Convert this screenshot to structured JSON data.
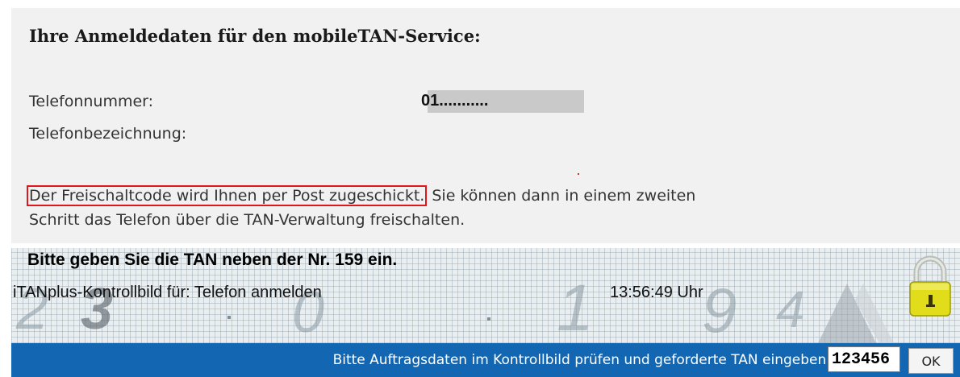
{
  "info": {
    "title": "Ihre Anmeldedaten für den mobileTAN-Service:",
    "phone_label": "Telefonnummer:",
    "phone_value": "01...........",
    "phone_name_label": "Telefonbezeichnung:",
    "notice_highlight": "Der Freischaltcode wird Ihnen per Post zugeschickt.",
    "notice_rest": " Sie können dann in einem zweiten",
    "notice_line2": "Schritt das Telefon über die TAN-Verwaltung freischalten."
  },
  "tan": {
    "instruction": "Bitte geben Sie die TAN neben der Nr. 159 ein.",
    "image_caption": "iTANplus-Kontrollbild für: Telefon anmelden",
    "time": "13:56:49 Uhr",
    "prompt": "Bitte Auftragsdaten im Kontrollbild prüfen und geforderte TAN eingeben:",
    "input_value": "123456",
    "ok_label": "OK",
    "lock_icon": "lock-icon",
    "colors": {
      "bar": "#1266b2",
      "highlight_border": "#e0161c",
      "lock": "#e9e21c"
    }
  }
}
